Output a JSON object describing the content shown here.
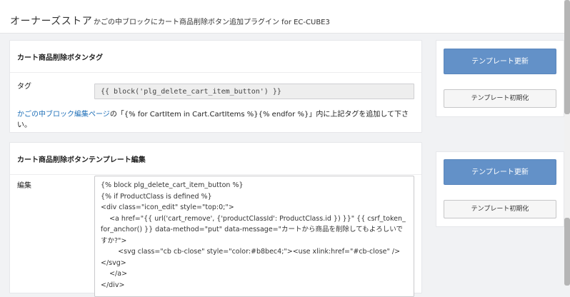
{
  "header": {
    "title": "オーナーズストア",
    "subtitle": "かごの中ブロックにカート商品削除ボタン追加プラグイン for EC-CUBE3"
  },
  "tag_card": {
    "heading": "カート商品削除ボタンタグ",
    "field_label": "タグ",
    "tag_value": "{{ block('plg_delete_cart_item_button') }}",
    "help_link": "かごの中ブロック編集ページ",
    "help_text": "の「{% for CartItem in Cart.CartItems %}{% endfor %}」内に上記タグを追加して下さい。"
  },
  "template_card": {
    "heading": "カート商品削除ボタンテンプレート編集",
    "field_label": "編集",
    "code": "{% block plg_delete_cart_item_button %}\n{% if ProductClass is defined %}\n<div class=\"icon_edit\" style=\"top:0;\">\n    <a href=\"{{ url('cart_remove', {'productClassId': ProductClass.id }) }}\" {{ csrf_token_for_anchor() }} data-method=\"put\" data-message=\"カートから商品を削除してもよろしいですか?\">\n        <svg class=\"cb cb-close\" style=\"color:#b8bec4;\"><use xlink:href=\"#cb-close\" /></svg>\n    </a>\n</div>"
  },
  "side_panel_1": {
    "update_label": "テンプレート更新",
    "reset_label": "テンプレート初期化"
  },
  "side_panel_2": {
    "update_label": "テンプレート更新",
    "reset_label": "テンプレート初期化"
  }
}
